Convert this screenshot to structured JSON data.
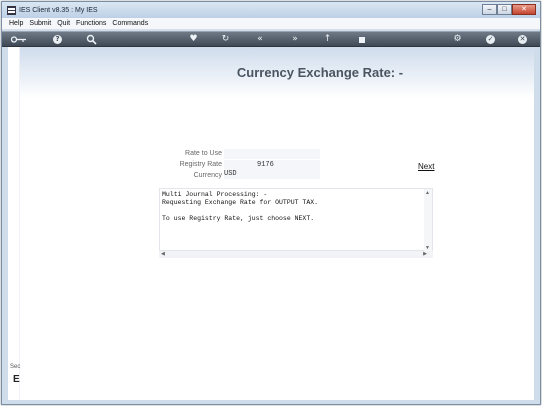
{
  "window": {
    "title": "IES Client v8.35 : My IES",
    "min_glyph": "–",
    "max_glyph": "□",
    "close_glyph": "✕"
  },
  "menu": [
    "Help",
    "Submit",
    "Quit",
    "Functions",
    "Commands"
  ],
  "toolbar": {
    "icons": [
      "key-icon",
      "help-icon",
      "search-icon",
      "heart-icon",
      "refresh-icon",
      "rewind-icon",
      "forward-icon",
      "upload-icon",
      "stop-icon",
      "settings-icon",
      "confirm-icon",
      "cancel-icon"
    ]
  },
  "page": {
    "title": "Currency Exchange Rate: -",
    "side_label": "Sec",
    "side_letter": "E"
  },
  "form": {
    "rate_to_use_label": "Rate to Use",
    "rate_to_use_value": "",
    "registry_rate_label": "Registry Rate",
    "registry_rate_value": "9176",
    "currency_label": "Currency",
    "currency_value": "USD"
  },
  "next_label": "Next",
  "message": {
    "text": "Multi Journal Processing: -\nRequesting Exchange Rate for OUTPUT TAX.\n\nTo use Registry Rate, just choose NEXT."
  }
}
